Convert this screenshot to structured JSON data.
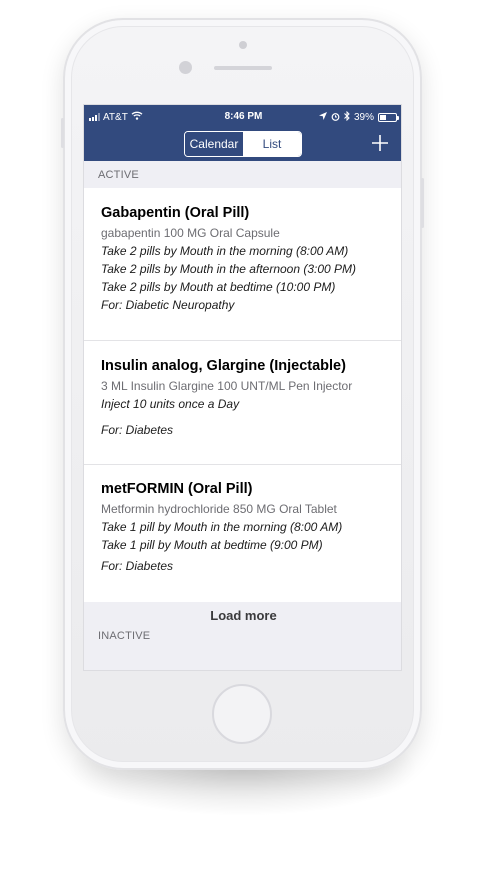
{
  "status_bar": {
    "carrier": "AT&T",
    "time": "8:46 PM",
    "battery_percent": "39%",
    "battery_level": 0.39,
    "icons": [
      "signal-icon",
      "wifi-icon",
      "location-icon",
      "alarm-icon",
      "bluetooth-icon",
      "battery-icon"
    ]
  },
  "nav": {
    "tabs": [
      {
        "label": "Calendar",
        "selected": false
      },
      {
        "label": "List",
        "selected": true
      }
    ],
    "add_icon": "plus-icon"
  },
  "sections": {
    "active_label": "ACTIVE",
    "inactive_label": "INACTIVE"
  },
  "medications": [
    {
      "name": "Gabapentin (Oral Pill)",
      "description": "gabapentin 100 MG Oral Capsule",
      "instructions": [
        "Take 2 pills by Mouth in the morning (8:00 AM)",
        "Take 2 pills by Mouth in the afternoon (3:00 PM)",
        "Take 2 pills by Mouth at bedtime (10:00 PM)"
      ],
      "for": "For: Diabetic Neuropathy"
    },
    {
      "name": "Insulin analog, Glargine (Injectable)",
      "description": "3 ML Insulin Glargine 100 UNT/ML Pen Injector",
      "instructions": [
        "Inject 10 units once a Day"
      ],
      "for": "For: Diabetes"
    },
    {
      "name": "metFORMIN (Oral Pill)",
      "description": "Metformin hydrochloride 850 MG Oral Tablet",
      "instructions": [
        "Take 1 pill by Mouth in the morning (8:00 AM)",
        "Take 1 pill by Mouth at bedtime (9:00 PM)"
      ],
      "for": "For: Diabetes"
    }
  ],
  "load_more_label": "Load more",
  "colors": {
    "nav_background": "#324a7e",
    "list_background": "#efeff4",
    "card_background": "#ffffff"
  }
}
